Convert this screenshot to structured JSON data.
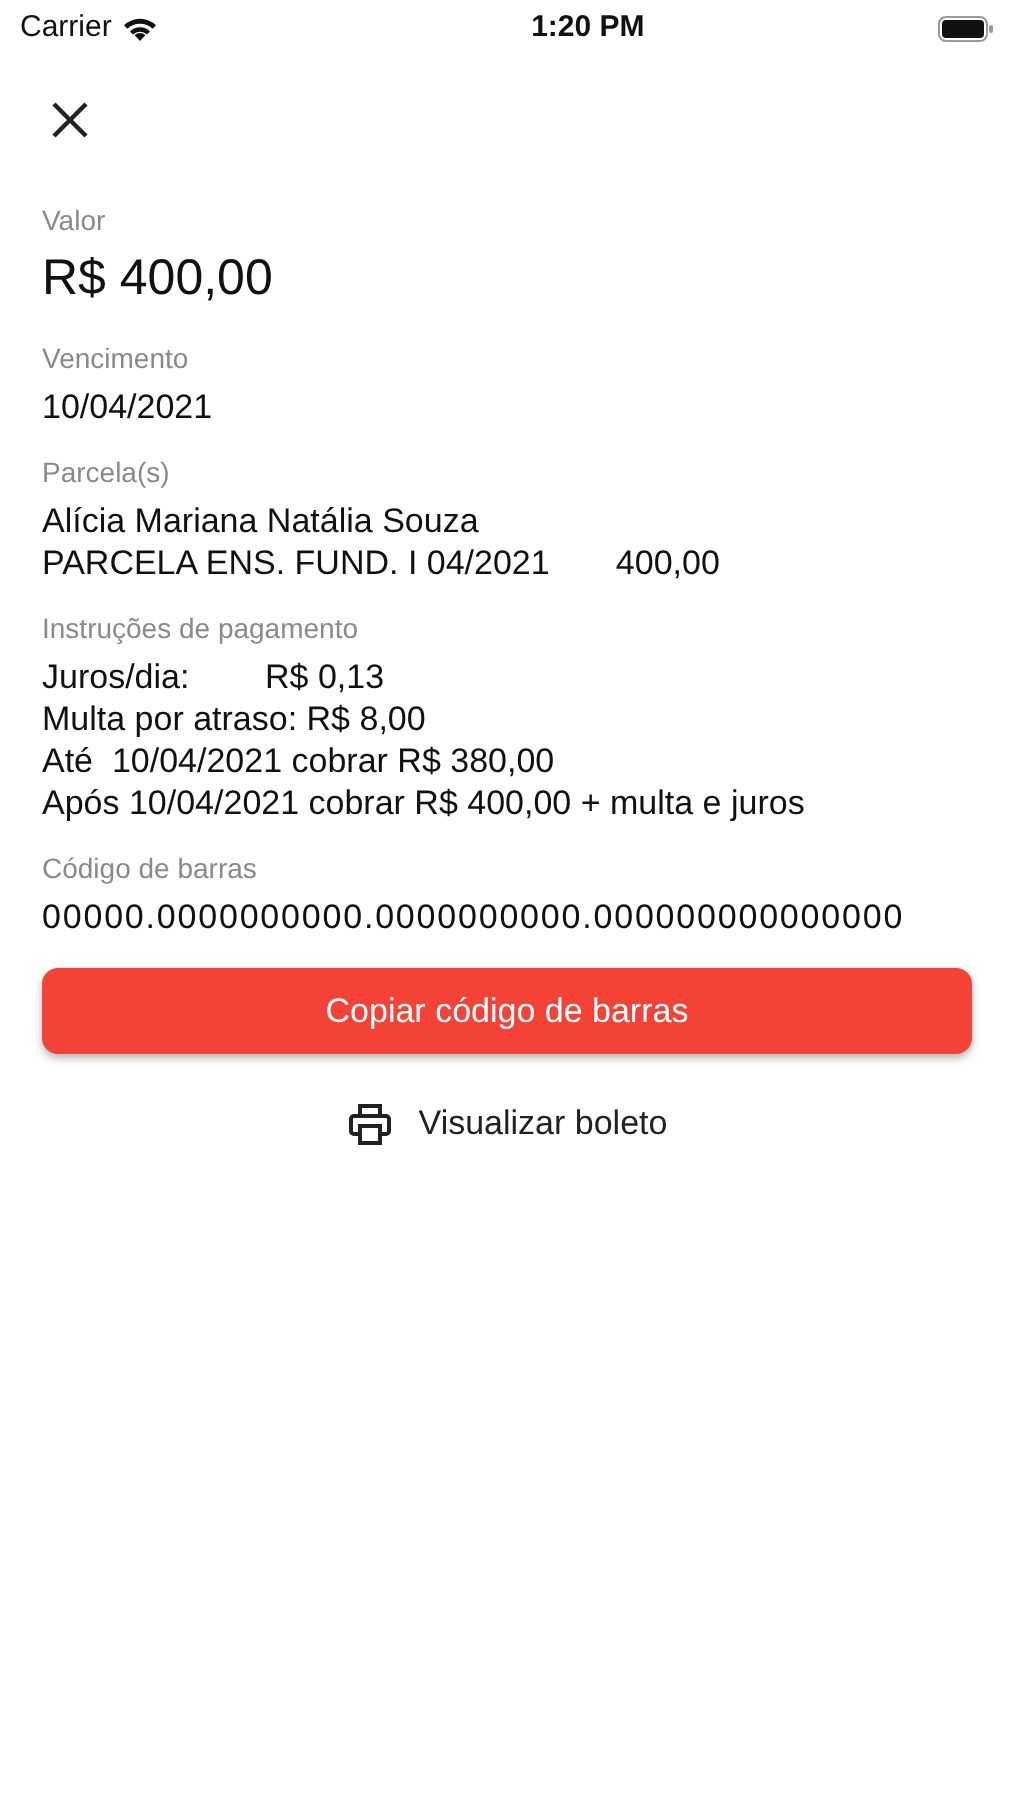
{
  "status_bar": {
    "carrier": "Carrier",
    "time": "1:20 PM"
  },
  "sections": [
    {
      "kind": "amount",
      "label": "Valor",
      "lines": [
        "R$ 400,00"
      ]
    },
    {
      "kind": "text",
      "label": "Vencimento",
      "lines": [
        "10/04/2021"
      ]
    },
    {
      "kind": "text",
      "label": "Parcela(s)",
      "lines": [
        "Alícia Mariana Natália Souza",
        "PARCELA ENS. FUND. I 04/2021       400,00"
      ]
    },
    {
      "kind": "text",
      "label": "Instruções de pagamento",
      "lines": [
        "Juros/dia:        R$ 0,13",
        "Multa por atraso: R$ 8,00",
        "Até  10/04/2021 cobrar R$ 380,00",
        "Após 10/04/2021 cobrar R$ 400,00 + multa e juros"
      ]
    },
    {
      "kind": "code",
      "label": "Código de barras",
      "lines": [
        "00000.0000000000.0000000000.000000000000000"
      ]
    }
  ],
  "copy_button": "Copiar código de barras",
  "view_link": "Visualizar boleto"
}
